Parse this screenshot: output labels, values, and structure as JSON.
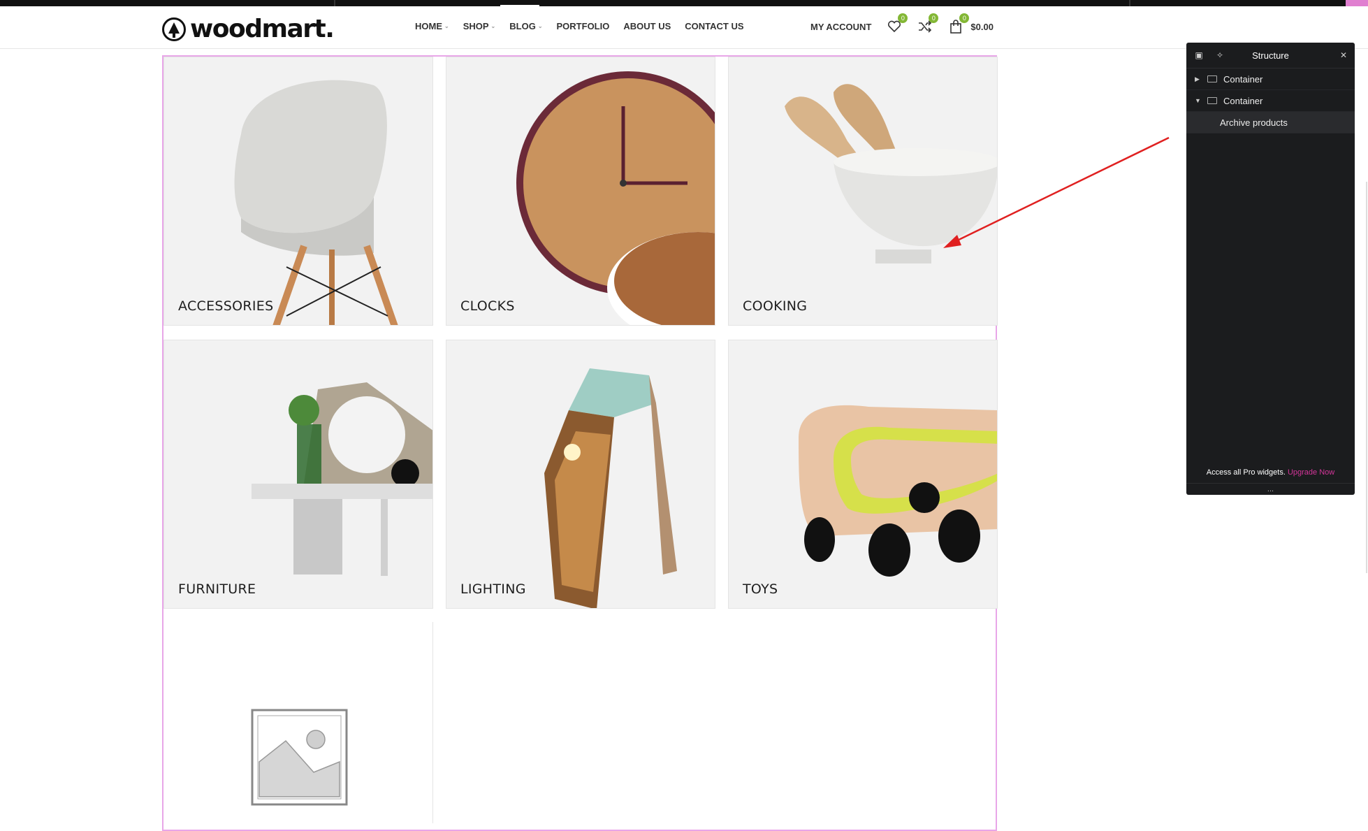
{
  "header": {
    "logo_text": "woodmart.",
    "nav": [
      {
        "label": "HOME",
        "has_dropdown": true
      },
      {
        "label": "SHOP",
        "has_dropdown": true
      },
      {
        "label": "BLOG",
        "has_dropdown": true
      },
      {
        "label": "PORTFOLIO",
        "has_dropdown": false
      },
      {
        "label": "ABOUT US",
        "has_dropdown": false
      },
      {
        "label": "CONTACT US",
        "has_dropdown": false
      }
    ],
    "account_label": "MY ACCOUNT",
    "wishlist_count": "0",
    "compare_count": "0",
    "cart_count": "0",
    "cart_total": "$0.00",
    "badge_color": "#83b735"
  },
  "categories": [
    {
      "label": "ACCESSORIES",
      "icon": "chair-image"
    },
    {
      "label": "CLOCKS",
      "icon": "clock-image"
    },
    {
      "label": "COOKING",
      "icon": "bowl-image"
    },
    {
      "label": "FURNITURE",
      "icon": "shelf-image"
    },
    {
      "label": "LIGHTING",
      "icon": "lamp-image"
    },
    {
      "label": "TOYS",
      "icon": "toy-car-image"
    },
    {
      "label": "",
      "icon": "placeholder-image"
    }
  ],
  "structure_panel": {
    "title": "Structure",
    "items": [
      {
        "label": "Container",
        "expanded": false
      },
      {
        "label": "Container",
        "expanded": true
      },
      {
        "label": "Archive products",
        "child": true
      }
    ],
    "footer_text": "Access all Pro widgets.",
    "footer_link": "Upgrade Now",
    "more": "..."
  },
  "colors": {
    "selection_outline": "#e8a6e8",
    "panel_bg": "#1b1c1e",
    "upgrade_link": "#d4359a",
    "annotation_arrow": "#e02020"
  }
}
